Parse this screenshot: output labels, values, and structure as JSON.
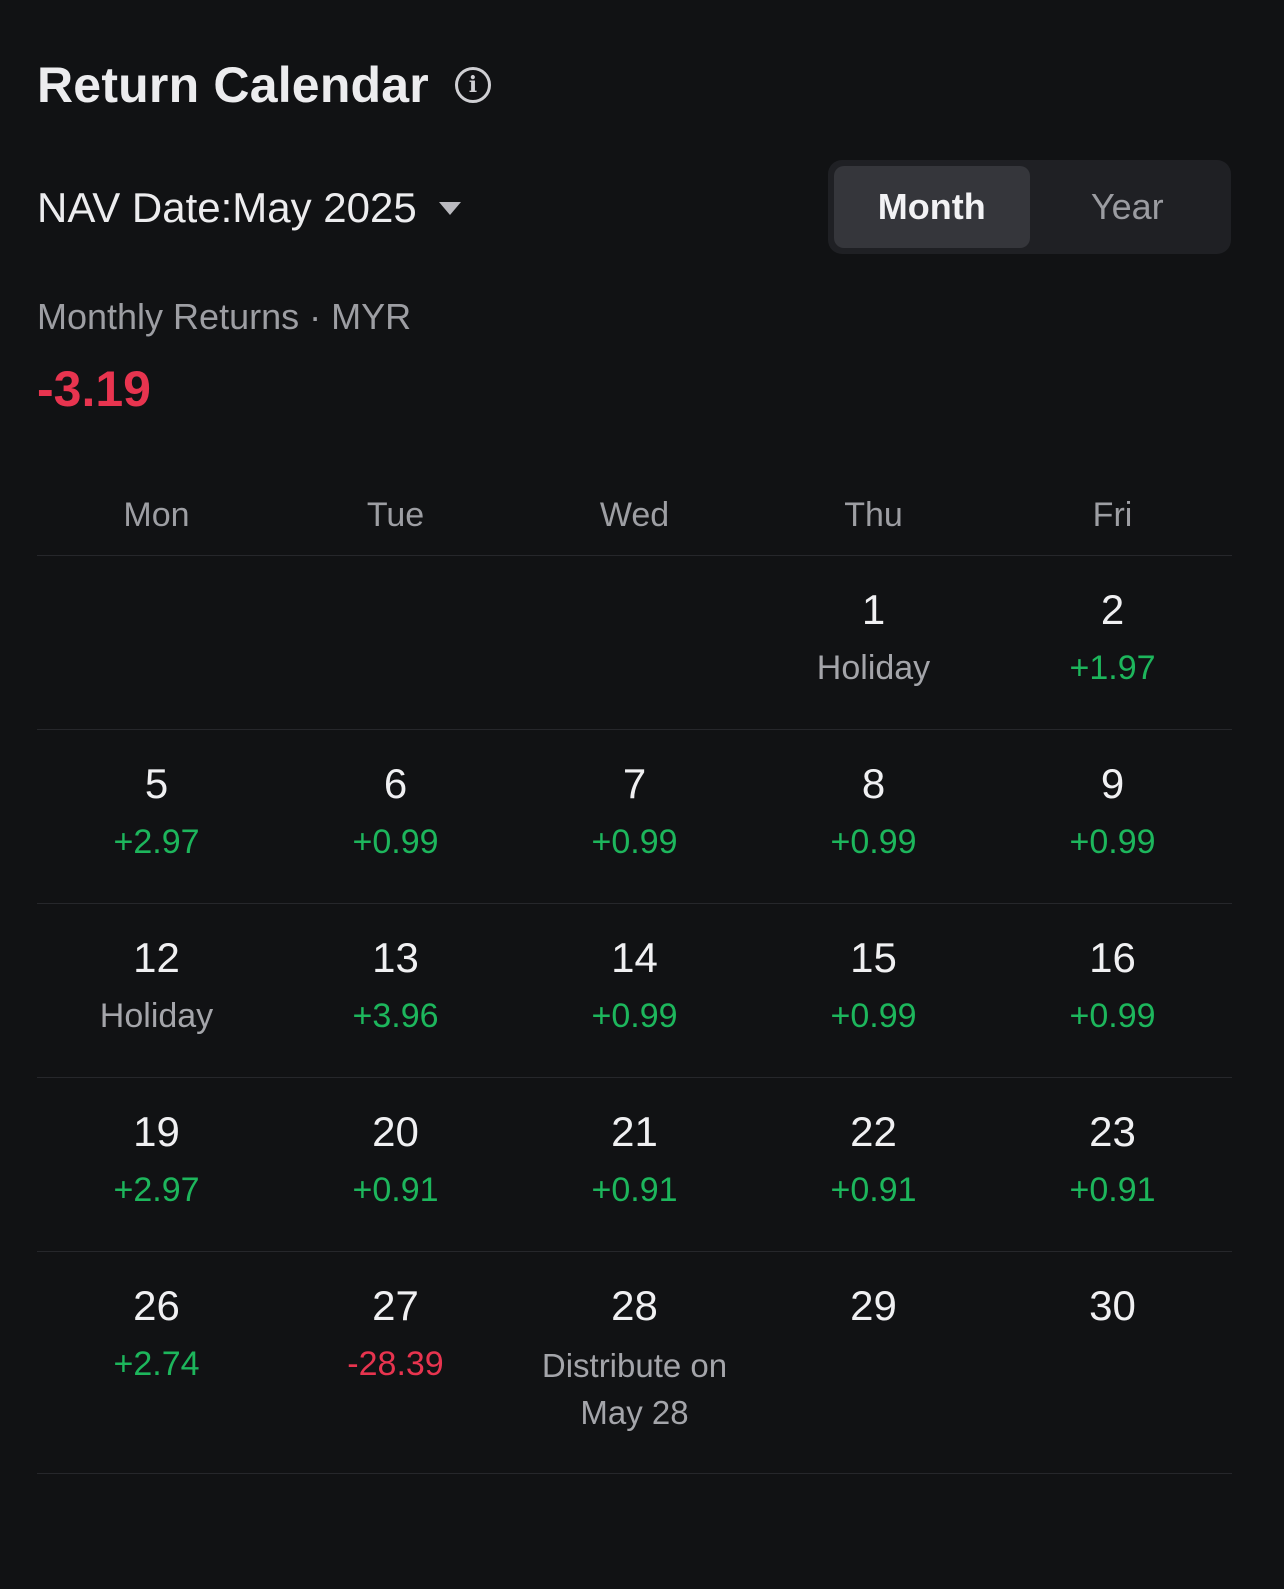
{
  "header": {
    "title": "Return Calendar",
    "info_icon": "info-circle-icon"
  },
  "nav": {
    "label": "NAV Date:May 2025",
    "caret_icon": "caret-down-icon"
  },
  "toggle": {
    "month": "Month",
    "year": "Year",
    "selected": "Month"
  },
  "summary": {
    "label": "Monthly Returns · MYR",
    "value": "-3.19"
  },
  "weekdays": [
    "Mon",
    "Tue",
    "Wed",
    "Thu",
    "Fri"
  ],
  "weeks": [
    [
      {
        "day": "",
        "value": ""
      },
      {
        "day": "",
        "value": ""
      },
      {
        "day": "",
        "value": ""
      },
      {
        "day": "1",
        "value": "Holiday"
      },
      {
        "day": "2",
        "value": "+1.97"
      }
    ],
    [
      {
        "day": "5",
        "value": "+2.97"
      },
      {
        "day": "6",
        "value": "+0.99"
      },
      {
        "day": "7",
        "value": "+0.99"
      },
      {
        "day": "8",
        "value": "+0.99"
      },
      {
        "day": "9",
        "value": "+0.99"
      }
    ],
    [
      {
        "day": "12",
        "value": "Holiday"
      },
      {
        "day": "13",
        "value": "+3.96"
      },
      {
        "day": "14",
        "value": "+0.99"
      },
      {
        "day": "15",
        "value": "+0.99"
      },
      {
        "day": "16",
        "value": "+0.99"
      }
    ],
    [
      {
        "day": "19",
        "value": "+2.97"
      },
      {
        "day": "20",
        "value": "+0.91"
      },
      {
        "day": "21",
        "value": "+0.91"
      },
      {
        "day": "22",
        "value": "+0.91"
      },
      {
        "day": "23",
        "value": "+0.91"
      }
    ],
    [
      {
        "day": "26",
        "value": "+2.74"
      },
      {
        "day": "27",
        "value": "-28.39"
      },
      {
        "day": "28",
        "value": "Distribute on May 28"
      },
      {
        "day": "29",
        "value": ""
      },
      {
        "day": "30",
        "value": ""
      }
    ]
  ],
  "colors": {
    "positive": "#1db65c",
    "negative": "#e8344f",
    "background": "#111214"
  }
}
